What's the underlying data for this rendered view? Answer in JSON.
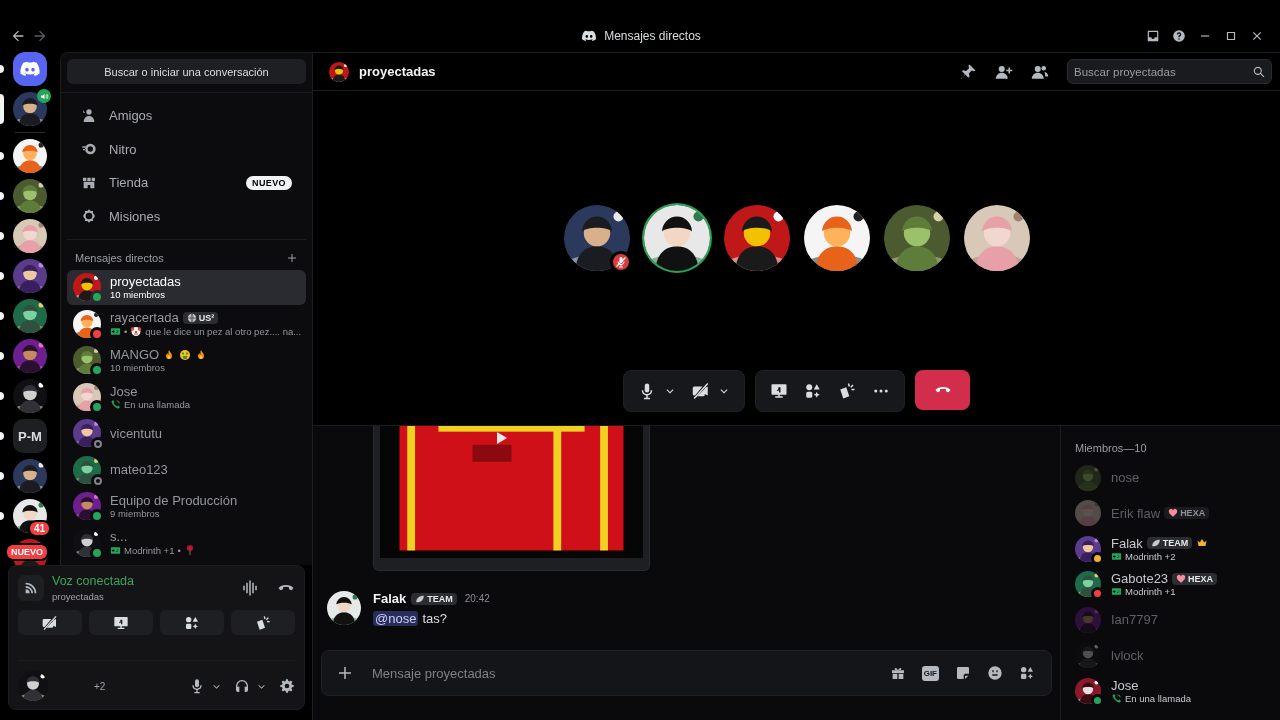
{
  "titlebar": {
    "title": "Mensajes directos"
  },
  "servers": [
    {
      "kind": "logo",
      "selected": false,
      "unread": true
    },
    {
      "kind": "voice",
      "selected": true,
      "unread": false
    },
    {
      "kind": "picture",
      "selected": false,
      "unread": true
    },
    {
      "kind": "picture",
      "selected": false,
      "unread": true
    },
    {
      "kind": "picture",
      "selected": false,
      "unread": true
    },
    {
      "kind": "picture",
      "selected": false,
      "unread": true
    },
    {
      "kind": "picture",
      "selected": false,
      "unread": true
    },
    {
      "kind": "picture",
      "selected": false,
      "unread": true
    },
    {
      "kind": "picture",
      "selected": false,
      "unread": true
    },
    {
      "kind": "acronym",
      "label": "P-M",
      "selected": false,
      "unread": true
    },
    {
      "kind": "picture",
      "selected": false,
      "unread": true
    },
    {
      "kind": "picture",
      "badge": "41",
      "selected": false,
      "unread": true
    },
    {
      "kind": "picture",
      "badge": "NUEVO",
      "selected": false,
      "unread": false
    }
  ],
  "search_button": {
    "label": "Buscar o iniciar una conversación"
  },
  "nav": [
    {
      "kind": "friends",
      "label": "Amigos"
    },
    {
      "kind": "nitro",
      "label": "Nitro"
    },
    {
      "kind": "shop",
      "label": "Tienda",
      "badge": "NUEVO"
    },
    {
      "kind": "quests",
      "label": "Misiones"
    }
  ],
  "dm_header": {
    "label": "Mensajes directos"
  },
  "dms": [
    {
      "name": "proyectadas",
      "color": "#23a55a",
      "offline": false,
      "selected": true,
      "sub": {
        "kind": "plain",
        "parts": [
          {
            "kind": "text",
            "text": "10 miembros"
          }
        ]
      }
    },
    {
      "name": "rayacertada",
      "tag": {
        "kind": "globe",
        "label": "US²"
      },
      "color": "#f23f43",
      "offline": false,
      "selected": false,
      "sub": {
        "kind": "activity",
        "parts": [
          {
            "kind": "text",
            "text": "•"
          },
          {
            "kind": "clown"
          },
          {
            "kind": "text",
            "text": "que le dice un pez al otro pez.... na..."
          }
        ]
      }
    },
    {
      "name": "MANGO",
      "name_emojis": [
        {
          "kind": "fire"
        },
        {
          "kind": "money"
        },
        {
          "kind": "fire"
        }
      ],
      "color": "#23a55a",
      "offline": false,
      "selected": false,
      "sub": {
        "kind": "plain",
        "parts": [
          {
            "kind": "text",
            "text": "10 miembros"
          }
        ]
      }
    },
    {
      "name": "Jose",
      "color": "#23a55a",
      "offline": false,
      "selected": false,
      "sub": {
        "kind": "call",
        "parts": [
          {
            "kind": "text",
            "text": "En una llamada"
          }
        ]
      }
    },
    {
      "name": "vicentutu",
      "color": "#80848e",
      "offline": true,
      "selected": false
    },
    {
      "name": "mateo123",
      "color": "#80848e",
      "offline": true,
      "selected": false
    },
    {
      "name": "Equipo de Producción",
      "color": "#23a55a",
      "offline": false,
      "selected": false,
      "sub": {
        "kind": "plain",
        "parts": [
          {
            "kind": "text",
            "text": "9 miembros"
          }
        ]
      }
    },
    {
      "name": "s...",
      "color": "#23a55a",
      "offline": false,
      "selected": false,
      "sub": {
        "kind": "activity",
        "parts": [
          {
            "kind": "text",
            "text": "Modrinth +1"
          },
          {
            "kind": "text",
            "text": "•"
          },
          {
            "kind": "rose"
          }
        ]
      }
    }
  ],
  "voice_panel": {
    "title": "Voz conectada",
    "channel": "proyectadas",
    "buttons": [
      {
        "kind": "camera-off"
      },
      {
        "kind": "screen"
      },
      {
        "kind": "activities"
      },
      {
        "kind": "soundboard"
      }
    ]
  },
  "user_panel": {
    "status_text": "+2"
  },
  "header": {
    "name": "proyectadas",
    "search_placeholder": "Buscar proyectadas"
  },
  "call": {
    "participants": [
      {
        "muted": true,
        "speaking": false
      },
      {
        "muted": false,
        "speaking": true
      },
      {
        "muted": false,
        "speaking": false
      },
      {
        "muted": false,
        "speaking": false
      },
      {
        "muted": false,
        "speaking": false
      },
      {
        "muted": false,
        "speaking": false
      }
    ]
  },
  "message": {
    "author": "Falak",
    "tag": "TEAM",
    "time": "20:42",
    "mention": "@nose",
    "text": "tas?"
  },
  "composer": {
    "placeholder": "Mensaje proyectadas",
    "gif_label": "GIF"
  },
  "members": {
    "title": "Miembros—10",
    "items": [
      {
        "name": "nose",
        "offline": true,
        "owner": false
      },
      {
        "name": "Erik flaw",
        "tag": {
          "kind": "heart",
          "label": "HEXA"
        },
        "offline": true,
        "owner": false
      },
      {
        "name": "Falak",
        "tag": {
          "kind": "leaf",
          "label": "TEAM"
        },
        "color": "#f0b232",
        "offline": false,
        "owner": true,
        "sub": {
          "kind": "activity",
          "text": "Modrinth +2"
        }
      },
      {
        "name": "Gabote23",
        "tag": {
          "kind": "heart",
          "label": "HEXA"
        },
        "color": "#f23f43",
        "offline": false,
        "owner": false,
        "sub": {
          "kind": "activity",
          "text": "Modrinth +1"
        }
      },
      {
        "name": "Ian7797",
        "offline": true,
        "owner": false
      },
      {
        "name": "lvlock",
        "offline": true,
        "owner": false
      },
      {
        "name": "Jose",
        "color": "#23a55a",
        "offline": false,
        "owner": false,
        "sub": {
          "kind": "call",
          "text": "En una llamada"
        }
      }
    ]
  }
}
